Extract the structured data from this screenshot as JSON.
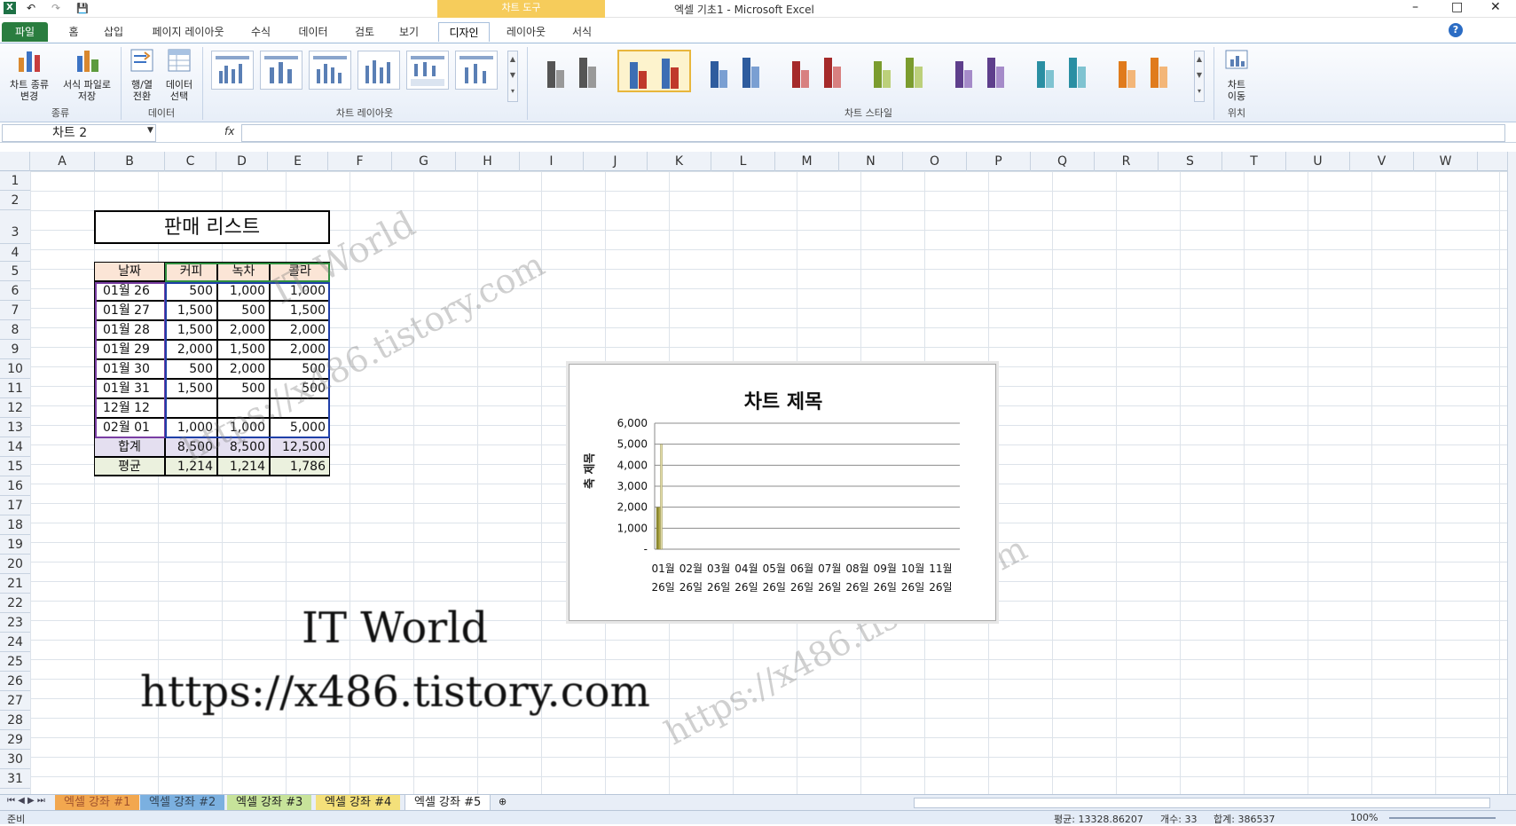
{
  "window": {
    "title": "엑셀 기초1  -  Microsoft Excel",
    "context_tab_group": "차트 도구"
  },
  "qat": {
    "undo": "↶",
    "redo": "↷",
    "save": "💾"
  },
  "ribbon_tabs": [
    "파일",
    "홈",
    "삽입",
    "페이지 레이아웃",
    "수식",
    "데이터",
    "검토",
    "보기",
    "디자인",
    "레이아웃",
    "서식"
  ],
  "ribbon": {
    "change_type": "차트 종류\n변경",
    "save_template": "서식 파일로\n저장",
    "switch_rowcol": "행/열\n전환",
    "select_data": "데이터\n선택",
    "move_chart": "차트\n이동",
    "group_type": "종류",
    "group_data": "데이터",
    "group_layouts": "차트 레이아웃",
    "group_styles": "차트 스타일",
    "group_location": "위치"
  },
  "formula_bar": {
    "name_box": "차트 2",
    "fx": "fx",
    "value": ""
  },
  "columns": [
    "A",
    "B",
    "C",
    "D",
    "E",
    "F",
    "G",
    "H",
    "I",
    "J",
    "K",
    "L",
    "M",
    "N",
    "O",
    "P",
    "Q",
    "R",
    "S",
    "T",
    "U",
    "V",
    "W"
  ],
  "rows": [
    "1",
    "2",
    "3",
    "4",
    "5",
    "6",
    "7",
    "8",
    "9",
    "10",
    "11",
    "12",
    "13",
    "14",
    "15",
    "16",
    "17",
    "18",
    "19",
    "20",
    "21",
    "22",
    "23",
    "24",
    "25",
    "26",
    "27",
    "28",
    "29",
    "30",
    "31"
  ],
  "sheet": {
    "title": "판매 리스트",
    "headers": [
      "날짜",
      "커피",
      "녹차",
      "콜라"
    ],
    "data": [
      [
        "01월 26일",
        "500",
        "1,000",
        "1,000"
      ],
      [
        "01월 27일",
        "1,500",
        "500",
        "1,500"
      ],
      [
        "01월 28일",
        "1,500",
        "2,000",
        "2,000"
      ],
      [
        "01월 29일",
        "2,000",
        "1,500",
        "2,000"
      ],
      [
        "01월 30일",
        "500",
        "2,000",
        "500"
      ],
      [
        "01월 31일",
        "1,500",
        "500",
        "500"
      ],
      [
        "12월 12일",
        "",
        "",
        ""
      ],
      [
        "02월 01일",
        "1,000",
        "1,000",
        "5,000"
      ]
    ],
    "total": [
      "합계",
      "8,500",
      "8,500",
      "12,500"
    ],
    "average": [
      "평균",
      "1,214",
      "1,214",
      "1,786"
    ]
  },
  "chart": {
    "title": "차트 제목",
    "ylabel": "축 제목",
    "yticks": [
      "6,000",
      "5,000",
      "4,000",
      "3,000",
      "2,000",
      "1,000",
      "-"
    ],
    "xticks": [
      [
        "01월",
        "26일"
      ],
      [
        "02월",
        "26일"
      ],
      [
        "03월",
        "26일"
      ],
      [
        "04월",
        "26일"
      ],
      [
        "05월",
        "26일"
      ],
      [
        "06월",
        "26일"
      ],
      [
        "07월",
        "26일"
      ],
      [
        "08월",
        "26일"
      ],
      [
        "09월",
        "26일"
      ],
      [
        "10월",
        "26일"
      ],
      [
        "11월",
        "26일"
      ]
    ]
  },
  "chart_data": {
    "type": "bar",
    "title": "차트 제목",
    "ylabel": "축 제목",
    "ylim": [
      0,
      6000
    ],
    "categories": [
      "01월 26일",
      "02월 26일",
      "03월 26일",
      "04월 26일",
      "05월 26일",
      "06월 26일",
      "07월 26일",
      "08월 26일",
      "09월 26일",
      "10월 26일",
      "11월 26일"
    ],
    "series": [
      {
        "values": [
          2000,
          0,
          0,
          0,
          0,
          0,
          0,
          0,
          0,
          0,
          0
        ]
      },
      {
        "values": [
          2000,
          0,
          0,
          0,
          0,
          0,
          0,
          0,
          0,
          0,
          0
        ]
      },
      {
        "values": [
          5000,
          0,
          0,
          0,
          0,
          0,
          0,
          0,
          0,
          0,
          0
        ]
      }
    ],
    "colors": [
      "#8e8a2f",
      "#b7ae4a",
      "#e3dca8"
    ],
    "grid": true
  },
  "watermark": {
    "line1": "IT World",
    "line2": "https://x486.tistory.com"
  },
  "sheet_tabs": [
    "엑셀 강좌 #1",
    "엑셀 강좌 #2",
    "엑셀 강좌 #3",
    "엑셀 강좌 #4",
    "엑셀 강좌 #5"
  ],
  "status": {
    "ready": "준비",
    "average": "평균: 13328.86207",
    "count": "개수: 33",
    "sum": "합계: 386537",
    "zoom": "100%"
  }
}
